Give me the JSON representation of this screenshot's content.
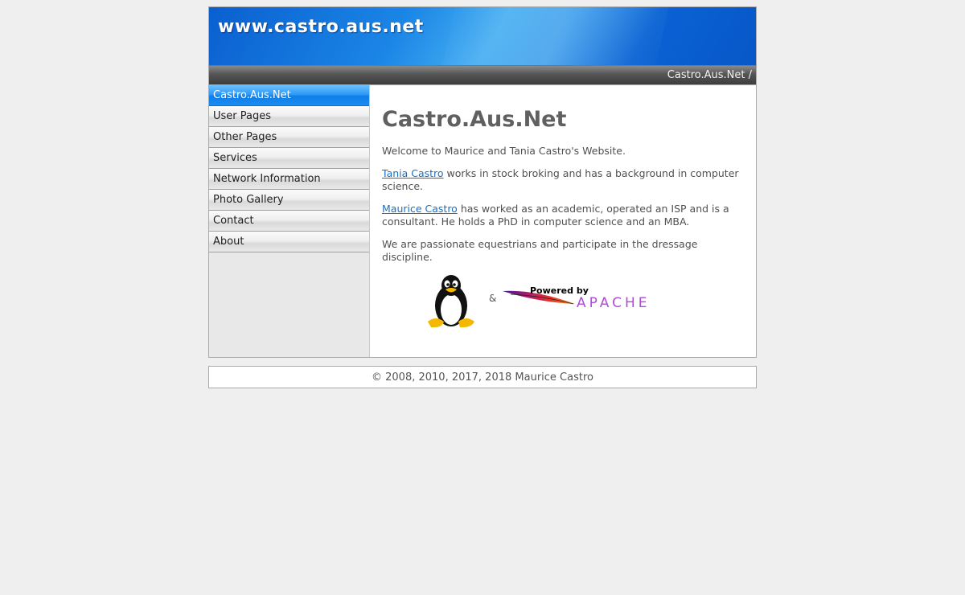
{
  "header": {
    "site_title": "www.castro.aus.net"
  },
  "breadcrumb": {
    "text": "Castro.Aus.Net /"
  },
  "sidebar": {
    "items": [
      {
        "label": "Castro.Aus.Net",
        "active": true
      },
      {
        "label": "User Pages"
      },
      {
        "label": "Other Pages"
      },
      {
        "label": "Services"
      },
      {
        "label": "Network Information"
      },
      {
        "label": "Photo Gallery"
      },
      {
        "label": "Contact"
      },
      {
        "label": "About"
      }
    ]
  },
  "content": {
    "title": "Castro.Aus.Net",
    "welcome": "Welcome to Maurice and Tania Castro's Website.",
    "tania_link": "Tania Castro",
    "tania_text": " works in stock broking and has a background in computer science.",
    "maurice_link": "Maurice Castro",
    "maurice_text": " has worked as an academic, operated an ISP and is a consultant. He holds a PhD in computer science and an MBA.",
    "equestrian": "We are passionate equestrians and participate in the dressage discipline.",
    "ampersand": "&",
    "apache_powered": "Powered by",
    "apache_name": "APACHE"
  },
  "footer": {
    "copyright": "© 2008, 2010, 2017, 2018 Maurice Castro"
  },
  "colors": {
    "header_blue": "#0a62d4",
    "nav_active": "#1e8cf0",
    "link": "#1a6fc4",
    "page_bg": "#efefef"
  }
}
